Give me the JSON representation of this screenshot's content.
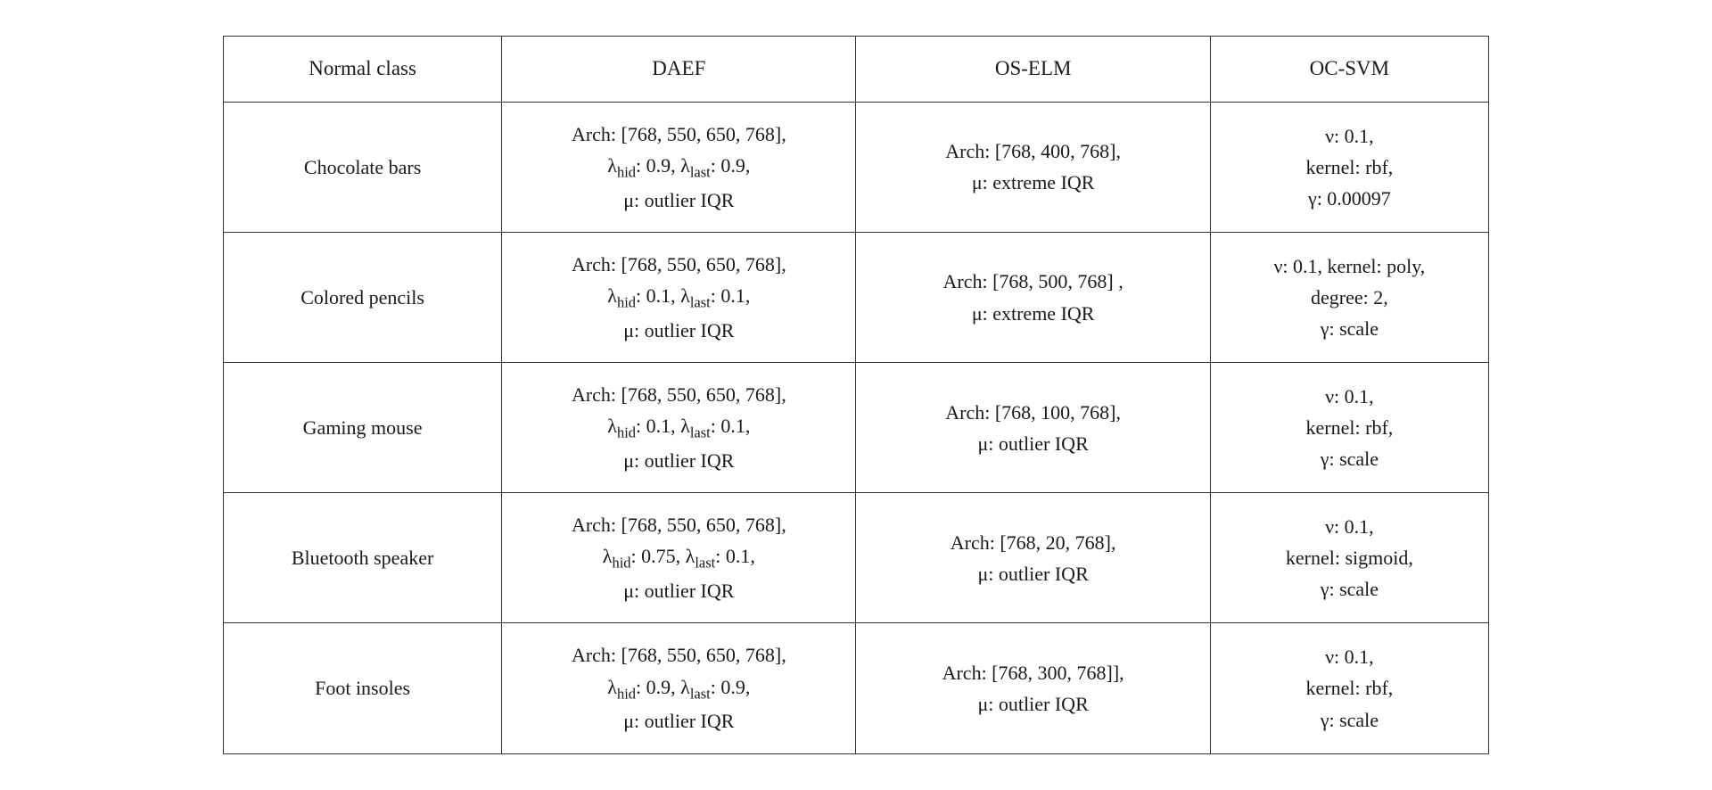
{
  "table": {
    "headers": {
      "col1": "Normal class",
      "col2": "DAEF",
      "col3": "OS-ELM",
      "col4": "OC-SVM"
    },
    "rows": [
      {
        "name": "Chocolate bars",
        "daef_line1": "Arch: [768, 550, 650, 768],",
        "daef_line2_pre": "λ",
        "daef_line2_sub1": "hid",
        "daef_line2_mid": ": 0.9, λ",
        "daef_line2_sub2": "last",
        "daef_line2_post": ": 0.9,",
        "daef_line3_pre": "μ",
        "daef_line3_post": ": outlier IQR",
        "oselm_line1": "Arch: [768, 400, 768],",
        "oselm_line2_pre": "μ",
        "oselm_line2_post": ": extreme IQR",
        "ocsvm_line1": "ν: 0.1,",
        "ocsvm_line2": "kernel: rbf,",
        "ocsvm_line3_pre": "γ",
        "ocsvm_line3_post": ": 0.00097"
      },
      {
        "name": "Colored pencils",
        "daef_line1": "Arch: [768, 550, 650, 768],",
        "daef_line2_pre": "λ",
        "daef_line2_sub1": "hid",
        "daef_line2_mid": ": 0.1, λ",
        "daef_line2_sub2": "last",
        "daef_line2_post": ": 0.1,",
        "daef_line3_pre": "μ",
        "daef_line3_post": ": outlier IQR",
        "oselm_line1": "Arch: [768, 500, 768] ,",
        "oselm_line2_pre": "μ",
        "oselm_line2_post": ": extreme IQR",
        "ocsvm_line1": "ν: 0.1, kernel: poly,",
        "ocsvm_line2": "degree: 2,",
        "ocsvm_line3_pre": "γ",
        "ocsvm_line3_post": ": scale"
      },
      {
        "name": "Gaming mouse",
        "daef_line1": "Arch: [768, 550, 650, 768],",
        "daef_line2_pre": "λ",
        "daef_line2_sub1": "hid",
        "daef_line2_mid": ": 0.1, λ",
        "daef_line2_sub2": "last",
        "daef_line2_post": ": 0.1,",
        "daef_line3_pre": "μ",
        "daef_line3_post": ": outlier IQR",
        "oselm_line1": "Arch: [768, 100, 768],",
        "oselm_line2_pre": "μ",
        "oselm_line2_post": ": outlier IQR",
        "ocsvm_line1": "ν: 0.1,",
        "ocsvm_line2": "kernel: rbf,",
        "ocsvm_line3_pre": "γ",
        "ocsvm_line3_post": ": scale"
      },
      {
        "name": "Bluetooth speaker",
        "daef_line1": "Arch: [768, 550, 650, 768],",
        "daef_line2_pre": "λ",
        "daef_line2_sub1": "hid",
        "daef_line2_mid": ": 0.75, λ",
        "daef_line2_sub2": "last",
        "daef_line2_post": ": 0.1,",
        "daef_line3_pre": "μ",
        "daef_line3_post": ": outlier IQR",
        "oselm_line1": "Arch: [768, 20, 768],",
        "oselm_line2_pre": "μ",
        "oselm_line2_post": ": outlier IQR",
        "ocsvm_line1": "ν: 0.1,",
        "ocsvm_line2": "kernel: sigmoid,",
        "ocsvm_line3_pre": "γ",
        "ocsvm_line3_post": ": scale"
      },
      {
        "name": "Foot insoles",
        "daef_line1": "Arch: [768, 550, 650, 768],",
        "daef_line2_pre": "λ",
        "daef_line2_sub1": "hid",
        "daef_line2_mid": ": 0.9, λ",
        "daef_line2_sub2": "last",
        "daef_line2_post": ": 0.9,",
        "daef_line3_pre": "μ",
        "daef_line3_post": ": outlier IQR",
        "oselm_line1": "Arch: [768, 300, 768]],",
        "oselm_line2_pre": "μ",
        "oselm_line2_post": ": outlier IQR",
        "ocsvm_line1": "ν: 0.1,",
        "ocsvm_line2": "kernel: rbf,",
        "ocsvm_line3_pre": "γ",
        "ocsvm_line3_post": ": scale"
      }
    ]
  }
}
